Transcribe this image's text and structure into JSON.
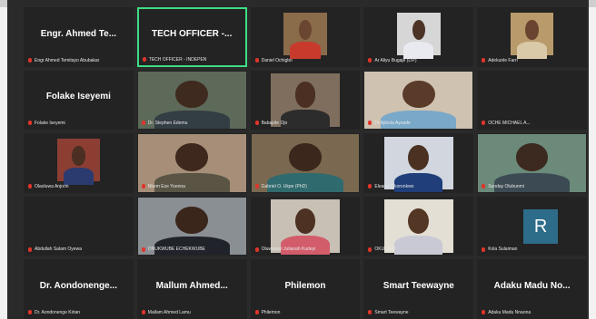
{
  "app": {
    "logo_icon": "video-conference-logo-icon"
  },
  "grid": [
    {
      "name": "Engr. Ahmed Te...",
      "label": "Engr Ahmed Temitayo Abubakar",
      "type": "avatar"
    },
    {
      "name": "TECH OFFICER -...",
      "label": "TECH OFFICER - INDEPEN",
      "type": "avatar",
      "active": true
    },
    {
      "name": "",
      "label": "Daniel Ochigbo",
      "type": "video-small",
      "skin": "#6a4630",
      "shirt": "#c83a2c",
      "bg": "#8a6b4a"
    },
    {
      "name": "",
      "label": "Ar Aliyu Bugaje (LIP)",
      "type": "video-small",
      "skin": "#4b3326",
      "shirt": "#e9e9f0",
      "bg": "#d6d6d6"
    },
    {
      "name": "",
      "label": "Adekunle Farri",
      "type": "video-small",
      "skin": "#6b4431",
      "shirt": "#d9c9a9",
      "bg": "#b89a6b"
    },
    {
      "name": "Folake Iseyemi",
      "label": "Folake Iseyemi",
      "type": "avatar"
    },
    {
      "name": "",
      "label": "Dr. Stephen Edemu",
      "type": "video",
      "skin": "#3f2a1f",
      "shirt": "#333d44",
      "bg": "#5d6a5a"
    },
    {
      "name": "",
      "label": "Babajide Ojo",
      "type": "video-center",
      "skin": "#4a2f22",
      "shirt": "#2c2c2c",
      "bg": "#7f6e5e"
    },
    {
      "name": "",
      "label": "Dr Ajibola Ayoade",
      "type": "video",
      "skin": "#5a3b2a",
      "shirt": "#7aa8c8",
      "bg": "#cfc2b0"
    },
    {
      "name": "",
      "label": "OCHE MICHAEL A...",
      "type": "avatar-blank"
    },
    {
      "name": "",
      "label": "Olaoluwa Anjorin",
      "type": "video-small",
      "skin": "#4b2f22",
      "shirt": "#2b3b70",
      "bg": "#8c3e33"
    },
    {
      "name": "",
      "label": "Nkem Eze Yoenna",
      "type": "video",
      "skin": "#3e281d",
      "shirt": "#5a5444",
      "bg": "#a68e78"
    },
    {
      "name": "",
      "label": "Gabriel O. Ukpe (PhD)",
      "type": "video",
      "skin": "#3b271c",
      "shirt": "#2f6a6e",
      "bg": "#7a6950"
    },
    {
      "name": "",
      "label": "Eleanyi Okoronkwo",
      "type": "video-center",
      "skin": "#4a3122",
      "shirt": "#1f3e7a",
      "bg": "#d1d6df"
    },
    {
      "name": "",
      "label": "Sunday Olubunmi",
      "type": "video",
      "skin": "#3c291f",
      "shirt": "#3b4a53",
      "bg": "#6b8a7a"
    },
    {
      "name": "",
      "label": "Abdullah Salam Oyewa",
      "type": "avatar-blank"
    },
    {
      "name": "",
      "label": "ONUKWUBE ECHEKWUBE",
      "type": "video",
      "skin": "#3a261b",
      "shirt": "#20242a",
      "bg": "#8a8f94"
    },
    {
      "name": "",
      "label": "Oluwaseyi Julianah Kudeyi",
      "type": "video-center",
      "skin": "#4d3122",
      "shirt": "#d35c6a",
      "bg": "#c8c0b4"
    },
    {
      "name": "",
      "label": "OKUOSKI",
      "type": "video-center",
      "skin": "#533624",
      "shirt": "#c9c9d6",
      "bg": "#e4dfd4"
    },
    {
      "name": "",
      "label": "Kola Sulaiman",
      "type": "avatar-r",
      "initial": "R"
    },
    {
      "name": "Dr. Aondonenge...",
      "label": "Dr. Aondonenge Kirian",
      "type": "avatar"
    },
    {
      "name": "Mallum Ahmed...",
      "label": "Mallam Ahmed Lamu",
      "type": "avatar"
    },
    {
      "name": "Philemon",
      "label": "Philemon",
      "type": "avatar"
    },
    {
      "name": "Smart Teewayne",
      "label": "Smart Teewayne",
      "type": "avatar"
    },
    {
      "name": "Adaku Madu No...",
      "label": "Adaku Madu Nnaona",
      "type": "avatar"
    }
  ]
}
